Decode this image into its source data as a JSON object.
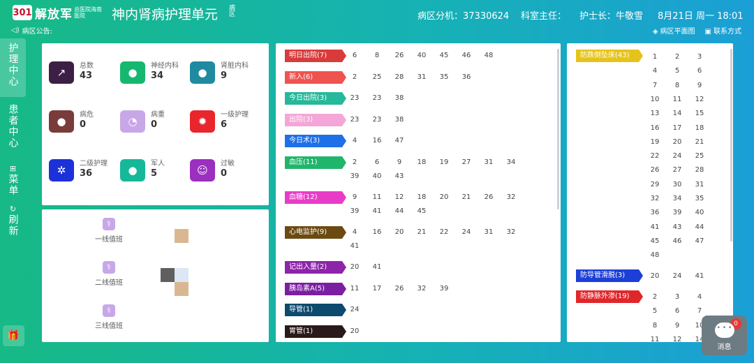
{
  "header": {
    "logo_mark": "301",
    "logo_text": "解放军",
    "logo_sub": "总医院海南医院",
    "unit_title": "神内肾病护理单元",
    "unit_tag": "病区",
    "extension": "病区分机：37330624",
    "director": "科室主任：",
    "head_nurse": "护士长：牛敬雪",
    "datetime": "8月21日 周一 18:01",
    "notice": "病区公告:",
    "link_floorplan": "病区平面图",
    "link_contact": "联系方式"
  },
  "nav": [
    {
      "label": "护理中心",
      "icon": ""
    },
    {
      "label": "患者中心",
      "icon": ""
    },
    {
      "label": "菜单",
      "icon": "grid-icon"
    },
    {
      "label": "刷新",
      "icon": "refresh-icon"
    }
  ],
  "stats": [
    {
      "label": "总数",
      "value": "43",
      "color": "#3d1f45",
      "icon": "chart-icon"
    },
    {
      "label": "神经内科",
      "value": "34",
      "color": "#16b86f",
      "icon": "user-icon"
    },
    {
      "label": "肾脏内科",
      "value": "9",
      "color": "#1f8aa0",
      "icon": "user-icon"
    },
    {
      "label": "病危",
      "value": "0",
      "color": "#7a3b3b",
      "icon": "user-icon"
    },
    {
      "label": "病重",
      "value": "0",
      "color": "#c8a7e8",
      "icon": "pie-icon"
    },
    {
      "label": "一级护理",
      "value": "6",
      "color": "#e8262b",
      "icon": "sun-icon"
    },
    {
      "label": "二级护理",
      "value": "36",
      "color": "#1c32d8",
      "icon": "gear-icon"
    },
    {
      "label": "军人",
      "value": "5",
      "color": "#16b89a",
      "icon": "user-icon"
    },
    {
      "label": "过敏",
      "value": "0",
      "color": "#9b2fbf",
      "icon": "face-icon"
    }
  ],
  "duty": [
    {
      "label": "一线值班"
    },
    {
      "label": "二线值班"
    },
    {
      "label": "三线值班"
    }
  ],
  "tasks": [
    {
      "label": "明日出院(7)",
      "color": "#d93b3b",
      "rows": [
        [
          "6",
          "8",
          "26",
          "40",
          "45",
          "46",
          "48"
        ]
      ]
    },
    {
      "label": "新入(6)",
      "color": "#ef5350",
      "rows": [
        [
          "2",
          "25",
          "28",
          "31",
          "35",
          "36"
        ]
      ]
    },
    {
      "label": "今日出院(3)",
      "color": "#26b89a",
      "rows": [
        [
          "23",
          "23",
          "38"
        ]
      ]
    },
    {
      "label": "出院(3)",
      "color": "#f4a6d8",
      "rows": [
        [
          "23",
          "23",
          "38"
        ]
      ]
    },
    {
      "label": "今日术(3)",
      "color": "#1e6fe8",
      "rows": [
        [
          "4",
          "16",
          "47"
        ]
      ]
    },
    {
      "label": "血压(11)",
      "color": "#21b56b",
      "rows": [
        [
          "2",
          "6",
          "9",
          "18",
          "19",
          "27",
          "31",
          "34"
        ],
        [
          "39",
          "40",
          "43"
        ]
      ]
    },
    {
      "label": "血糖(12)",
      "color": "#e83cc8",
      "rows": [
        [
          "9",
          "11",
          "12",
          "18",
          "20",
          "21",
          "26",
          "32"
        ],
        [
          "39",
          "41",
          "44",
          "45"
        ]
      ]
    },
    {
      "label": "心电监护(9)",
      "color": "#6b4a12",
      "rows": [
        [
          "4",
          "16",
          "20",
          "21",
          "22",
          "24",
          "31",
          "32"
        ],
        [
          "41"
        ]
      ]
    },
    {
      "label": "记出入量(2)",
      "color": "#8e24aa",
      "rows": [
        [
          "20",
          "41"
        ]
      ]
    },
    {
      "label": "胰岛素A(5)",
      "color": "#7b1fa2",
      "rows": [
        [
          "11",
          "17",
          "26",
          "32",
          "39"
        ]
      ]
    },
    {
      "label": "导管(1)",
      "color": "#0d4a6e",
      "rows": [
        [
          "24"
        ]
      ]
    },
    {
      "label": "胃管(1)",
      "color": "#2a1a1a",
      "rows": [
        [
          "20"
        ]
      ]
    }
  ],
  "right_tasks": [
    {
      "label": "防跌倒坠床(43)",
      "color": "#e6c31a",
      "rows": [
        [
          "1",
          "2",
          "3"
        ],
        [
          "4",
          "5",
          "6"
        ],
        [
          "7",
          "8",
          "9"
        ],
        [
          "10",
          "11",
          "12"
        ],
        [
          "13",
          "14",
          "15"
        ],
        [
          "16",
          "17",
          "18"
        ],
        [
          "19",
          "20",
          "21"
        ],
        [
          "22",
          "24",
          "25"
        ],
        [
          "26",
          "27",
          "28"
        ],
        [
          "29",
          "30",
          "31"
        ],
        [
          "32",
          "34",
          "35"
        ],
        [
          "36",
          "39",
          "40"
        ],
        [
          "41",
          "43",
          "44"
        ],
        [
          "45",
          "46",
          "47"
        ],
        [
          "48"
        ]
      ]
    },
    {
      "label": "防导管滑脱(3)",
      "color": "#1c3fd8",
      "rows": [
        [
          "20",
          "24",
          "41"
        ]
      ]
    },
    {
      "label": "防静脉外渗(19)",
      "color": "#e0262b",
      "rows": [
        [
          "2",
          "3",
          "4"
        ],
        [
          "5",
          "6",
          "7"
        ],
        [
          "8",
          "9",
          "10"
        ],
        [
          "11",
          "12",
          "14"
        ]
      ]
    }
  ],
  "message": {
    "label": "消息",
    "count": "0"
  }
}
